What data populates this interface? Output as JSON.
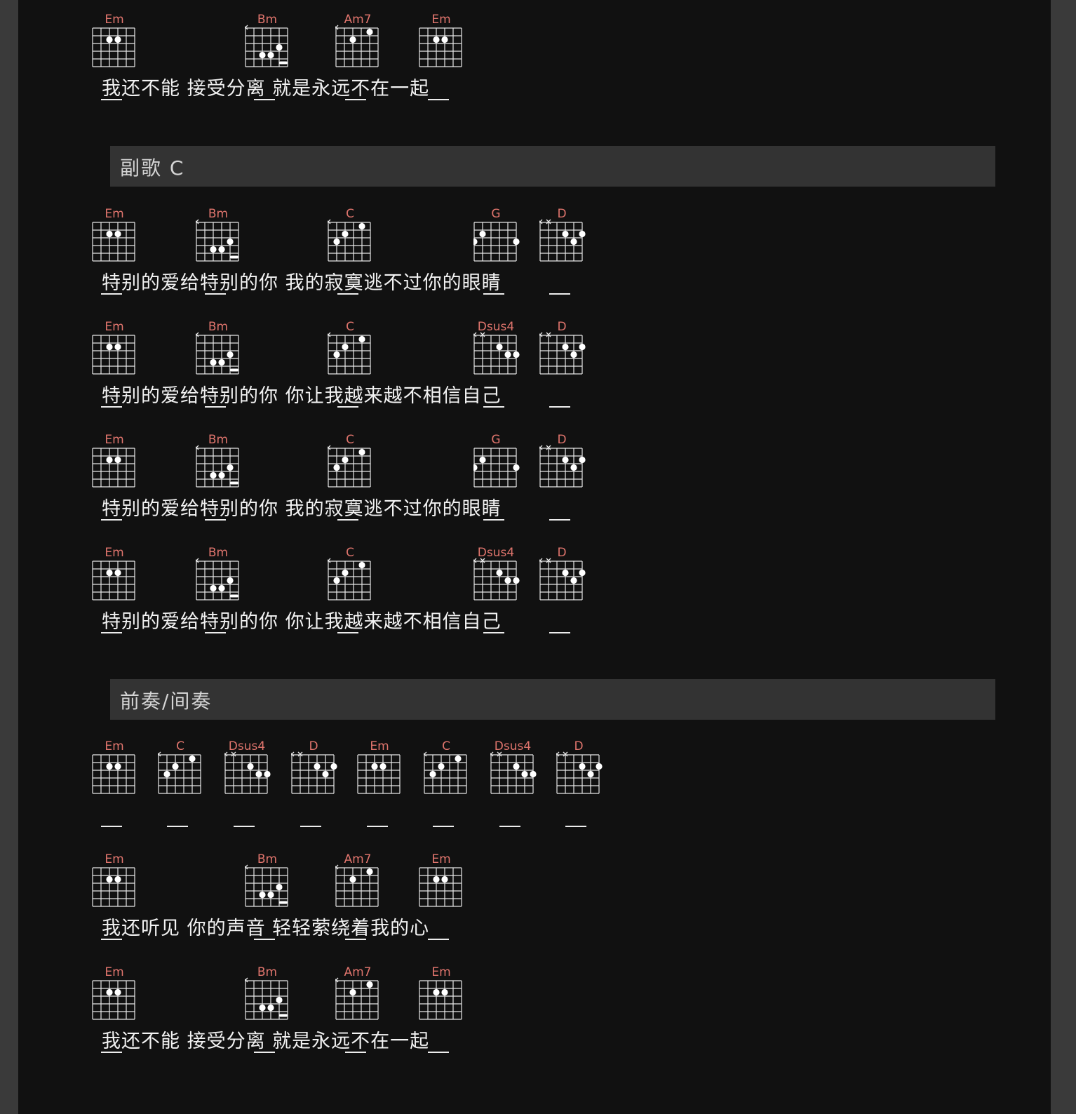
{
  "colors": {
    "page": "#111111",
    "gutter": "#3a3a3a",
    "header": "#333333",
    "chord_name": "#e0756d",
    "lyric": "#f2f2f2",
    "grid": "#e8e8e8"
  },
  "chords": {
    "Em": {
      "name": "Em",
      "mutes": [],
      "barre": null,
      "dots": [
        [
          4,
          2
        ],
        [
          3,
          2
        ]
      ]
    },
    "Bm": {
      "name": "Bm",
      "mutes": [
        6
      ],
      "barre": [
        5,
        1,
        2
      ],
      "dots": [
        [
          2,
          3
        ],
        [
          4,
          4
        ],
        [
          3,
          4
        ]
      ]
    },
    "Am7": {
      "name": "Am7",
      "mutes": [
        6
      ],
      "barre": null,
      "dots": [
        [
          2,
          1
        ],
        [
          4,
          2
        ]
      ]
    },
    "C": {
      "name": "C",
      "mutes": [
        6
      ],
      "barre": null,
      "dots": [
        [
          2,
          1
        ],
        [
          4,
          2
        ],
        [
          5,
          3
        ]
      ]
    },
    "G": {
      "name": "G",
      "mutes": [],
      "barre": null,
      "dots": [
        [
          5,
          2
        ],
        [
          6,
          3
        ],
        [
          1,
          3
        ]
      ]
    },
    "D": {
      "name": "D",
      "mutes": [
        6,
        5
      ],
      "barre": null,
      "dots": [
        [
          3,
          2
        ],
        [
          1,
          2
        ],
        [
          2,
          3
        ]
      ]
    },
    "Dsus4": {
      "name": "Dsus4",
      "mutes": [
        6,
        5
      ],
      "barre": null,
      "dots": [
        [
          3,
          2
        ],
        [
          2,
          3
        ],
        [
          1,
          3
        ]
      ]
    }
  },
  "sections": [
    {
      "title": "副歌 C"
    },
    {
      "title": "前奏/间奏"
    }
  ],
  "rows": [
    {
      "id": "r1",
      "lyric": "我还不能 接受分离 就是永远不在一起",
      "chords": [
        "Em",
        "Bm",
        "Am7",
        "Em"
      ]
    },
    {
      "id": "r2",
      "lyric": "特别的爱给特别的你 我的寂寞逃不过你的眼睛",
      "chords": [
        "Em",
        "Bm",
        "C",
        "G",
        "D"
      ]
    },
    {
      "id": "r3",
      "lyric": "特别的爱给特别的你 你让我越来越不相信自己",
      "chords": [
        "Em",
        "Bm",
        "C",
        "Dsus4",
        "D"
      ]
    },
    {
      "id": "r4",
      "lyric": "特别的爱给特别的你 我的寂寞逃不过你的眼睛",
      "chords": [
        "Em",
        "Bm",
        "C",
        "G",
        "D"
      ]
    },
    {
      "id": "r5",
      "lyric": "特别的爱给特别的你 你让我越来越不相信自己",
      "chords": [
        "Em",
        "Bm",
        "C",
        "Dsus4",
        "D"
      ]
    },
    {
      "id": "r6",
      "lyric": "",
      "chords": [
        "Em",
        "C",
        "Dsus4",
        "D",
        "Em",
        "C",
        "Dsus4",
        "D"
      ]
    },
    {
      "id": "r7",
      "lyric": "我还听见 你的声音 轻轻萦绕着我的心",
      "chords": [
        "Em",
        "Bm",
        "Am7",
        "Em"
      ]
    },
    {
      "id": "r8",
      "lyric": "我还不能 接受分离 就是永远不在一起",
      "chords": [
        "Em",
        "Bm",
        "Am7",
        "Em"
      ]
    }
  ]
}
